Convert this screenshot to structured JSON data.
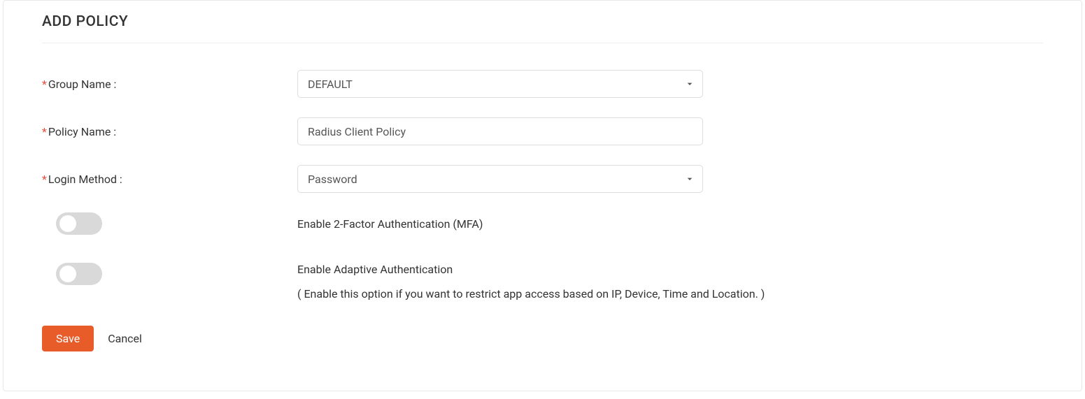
{
  "title": "ADD POLICY",
  "form": {
    "group_name": {
      "label": "Group Name :",
      "selected": "DEFAULT"
    },
    "policy_name": {
      "label": "Policy Name :",
      "value": "Radius Client Policy"
    },
    "login_method": {
      "label": "Login Method :",
      "selected": "Password"
    },
    "mfa": {
      "label": "Enable 2-Factor Authentication (MFA)",
      "enabled": false
    },
    "adaptive": {
      "label": "Enable Adaptive Authentication",
      "hint": "( Enable this option if you want to restrict app access based on IP, Device, Time and Location. )",
      "enabled": false
    }
  },
  "buttons": {
    "save": "Save",
    "cancel": "Cancel"
  },
  "required_marker": "*"
}
